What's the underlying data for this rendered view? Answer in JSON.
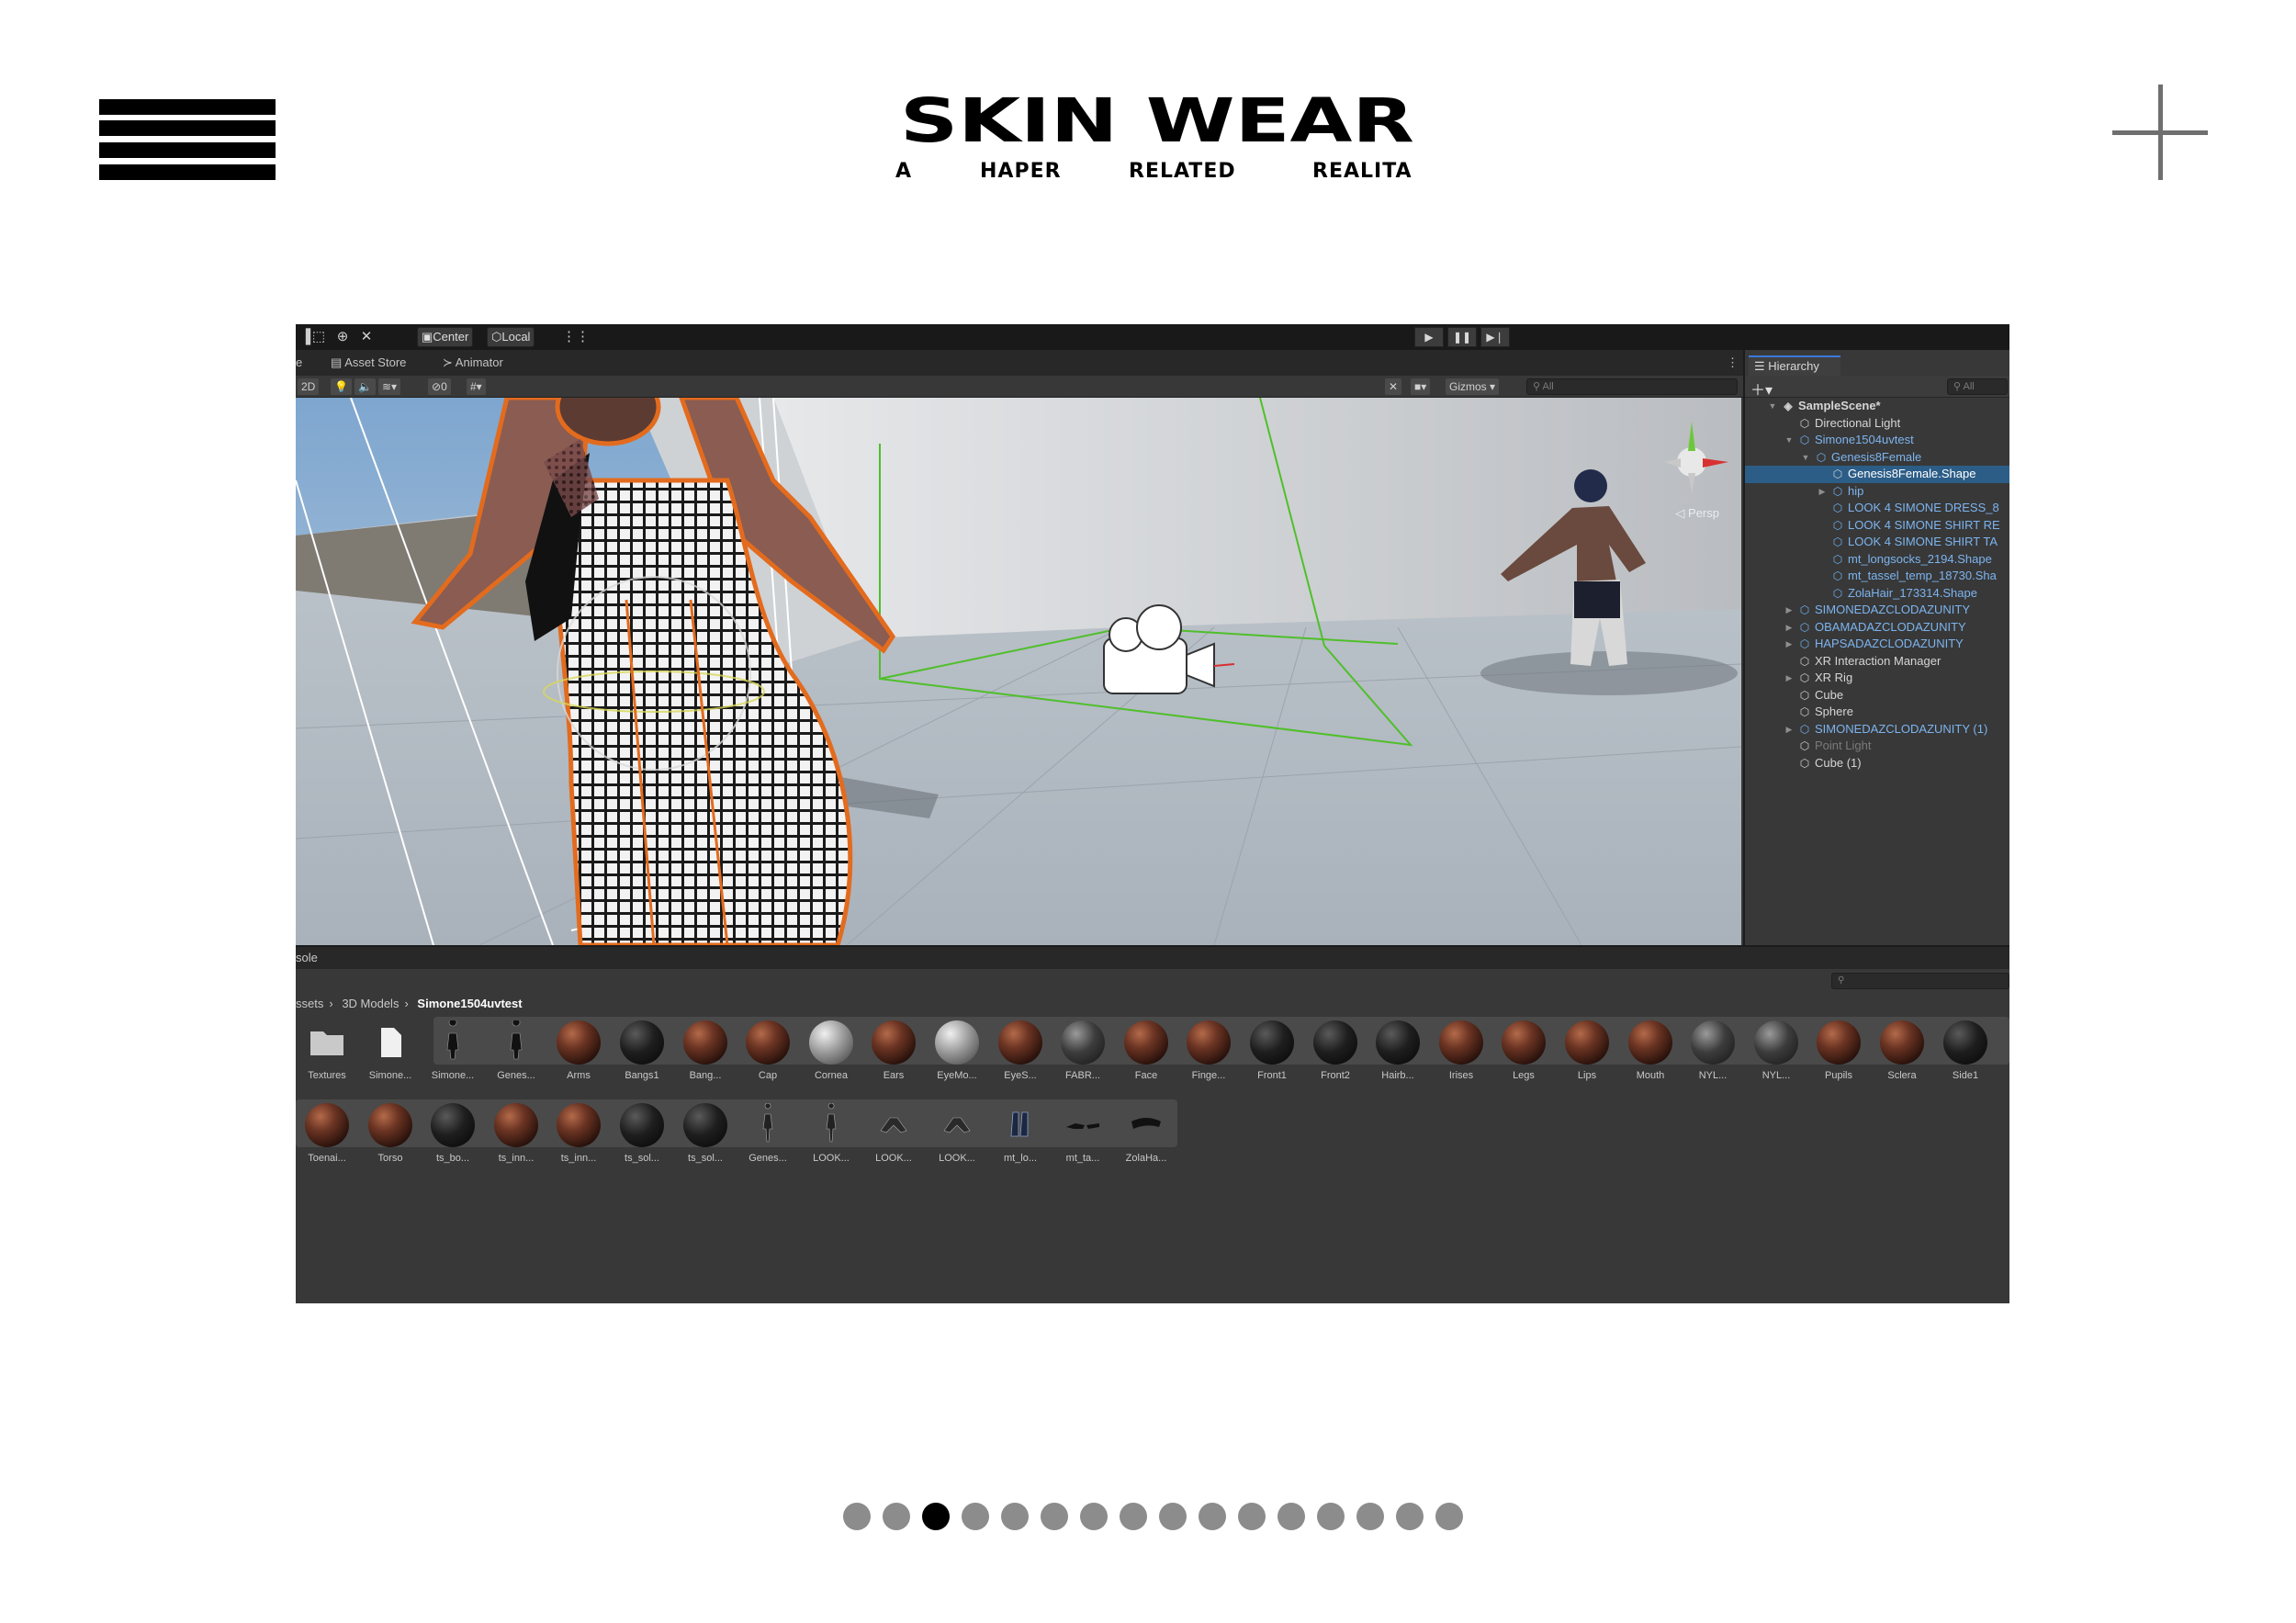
{
  "site": {
    "title": "SKIN WEAR",
    "subtitle_words": [
      "A",
      "HAPER",
      "RELATED",
      "REALITA"
    ],
    "menu_icon": "hamburger-menu-icon",
    "add_icon": "plus-icon"
  },
  "unity": {
    "toolbar": {
      "pivot_label": "Center",
      "space_label": "Local"
    },
    "tabs": [
      "e",
      "Asset Store",
      "Animator"
    ],
    "scene_bar": {
      "mode_2d": "2D",
      "hidden_count": "0",
      "gizmos_label": "Gizmos",
      "search_placeholder": "All"
    },
    "scene": {
      "persp_label": "Persp"
    },
    "hierarchy": {
      "tab_label": "Hierarchy",
      "search_placeholder": "All",
      "items": [
        {
          "label": "SampleScene*",
          "depth": 0,
          "style": "bold",
          "expanded": true
        },
        {
          "label": "Directional Light",
          "depth": 1,
          "style": "normal"
        },
        {
          "label": "Simone1504uvtest",
          "depth": 1,
          "style": "blue",
          "expanded": true
        },
        {
          "label": "Genesis8Female",
          "depth": 2,
          "style": "blue",
          "expanded": true
        },
        {
          "label": "Genesis8Female.Shape",
          "depth": 3,
          "style": "selected"
        },
        {
          "label": "hip",
          "depth": 3,
          "style": "blue",
          "collapsed": true
        },
        {
          "label": "LOOK 4 SIMONE DRESS_8",
          "depth": 3,
          "style": "blue"
        },
        {
          "label": "LOOK 4 SIMONE SHIRT RE",
          "depth": 3,
          "style": "blue"
        },
        {
          "label": "LOOK 4 SIMONE SHIRT TA",
          "depth": 3,
          "style": "blue"
        },
        {
          "label": "mt_longsocks_2194.Shape",
          "depth": 3,
          "style": "blue"
        },
        {
          "label": "mt_tassel_temp_18730.Sha",
          "depth": 3,
          "style": "blue"
        },
        {
          "label": "ZolaHair_173314.Shape",
          "depth": 3,
          "style": "blue"
        },
        {
          "label": "SIMONEDAZCLODAZUNITY",
          "depth": 1,
          "style": "blue",
          "collapsed": true
        },
        {
          "label": "OBAMADAZCLODAZUNITY",
          "depth": 1,
          "style": "blue",
          "collapsed": true
        },
        {
          "label": "HAPSADAZCLODAZUNITY",
          "depth": 1,
          "style": "blue",
          "collapsed": true
        },
        {
          "label": "XR Interaction Manager",
          "depth": 1,
          "style": "normal"
        },
        {
          "label": "XR Rig",
          "depth": 1,
          "style": "normal",
          "collapsed": true
        },
        {
          "label": "Cube",
          "depth": 1,
          "style": "normal"
        },
        {
          "label": "Sphere",
          "depth": 1,
          "style": "normal"
        },
        {
          "label": "SIMONEDAZCLODAZUNITY (1)",
          "depth": 1,
          "style": "blue",
          "collapsed": true
        },
        {
          "label": "Point Light",
          "depth": 1,
          "style": "dim"
        },
        {
          "label": "Cube (1)",
          "depth": 1,
          "style": "normal"
        }
      ]
    },
    "console": {
      "tab_label": "sole",
      "breadcrumb": [
        "ssets",
        "3D Models",
        "Simone1504uvtest"
      ],
      "assets_row1": [
        {
          "name": "Textures",
          "kind": "folder"
        },
        {
          "name": "Simone...",
          "kind": "file"
        },
        {
          "name": "Simone...",
          "kind": "model"
        },
        {
          "name": "Genes...",
          "kind": "model"
        },
        {
          "name": "Arms",
          "kind": "skin"
        },
        {
          "name": "Bangs1",
          "kind": "black"
        },
        {
          "name": "Bang...",
          "kind": "skin"
        },
        {
          "name": "Cap",
          "kind": "skin"
        },
        {
          "name": "Cornea",
          "kind": "grey"
        },
        {
          "name": "Ears",
          "kind": "skin"
        },
        {
          "name": "EyeMo...",
          "kind": "grey"
        },
        {
          "name": "EyeS...",
          "kind": "skin"
        },
        {
          "name": "FABR...",
          "kind": "fabric"
        },
        {
          "name": "Face",
          "kind": "skin"
        },
        {
          "name": "Finge...",
          "kind": "skin"
        },
        {
          "name": "Front1",
          "kind": "black"
        },
        {
          "name": "Front2",
          "kind": "black"
        },
        {
          "name": "Hairb...",
          "kind": "black"
        },
        {
          "name": "Irises",
          "kind": "skin"
        },
        {
          "name": "Legs",
          "kind": "skin"
        },
        {
          "name": "Lips",
          "kind": "skin"
        },
        {
          "name": "Mouth",
          "kind": "skin"
        },
        {
          "name": "NYL...",
          "kind": "fabric"
        },
        {
          "name": "NYL...",
          "kind": "fabric"
        },
        {
          "name": "Pupils",
          "kind": "skin"
        },
        {
          "name": "Sclera",
          "kind": "skin"
        },
        {
          "name": "Side1",
          "kind": "black"
        }
      ],
      "assets_row2": [
        {
          "name": "Toenai...",
          "kind": "skin"
        },
        {
          "name": "Torso",
          "kind": "skin"
        },
        {
          "name": "ts_bo...",
          "kind": "black"
        },
        {
          "name": "ts_inn...",
          "kind": "skin"
        },
        {
          "name": "ts_inn...",
          "kind": "skin"
        },
        {
          "name": "ts_sol...",
          "kind": "black"
        },
        {
          "name": "ts_sol...",
          "kind": "black"
        },
        {
          "name": "Genes...",
          "kind": "figure"
        },
        {
          "name": "LOOK...",
          "kind": "figure"
        },
        {
          "name": "LOOK...",
          "kind": "garment"
        },
        {
          "name": "LOOK...",
          "kind": "garment"
        },
        {
          "name": "mt_lo...",
          "kind": "socks"
        },
        {
          "name": "mt_ta...",
          "kind": "tassel"
        },
        {
          "name": "ZolaHa...",
          "kind": "hair"
        }
      ]
    }
  },
  "pagination": {
    "count": 16,
    "active_index": 2
  },
  "colors": {
    "selection": "#2c5d87",
    "hierarchy_blue": "#7cb4ef",
    "outline_orange": "#e36b1e",
    "bounds_green": "#4fbf2a"
  }
}
